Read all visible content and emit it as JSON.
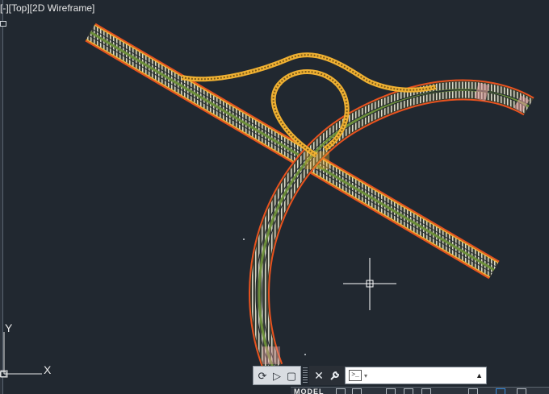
{
  "viewport": {
    "label": "[-][Top][2D Wireframe]",
    "background": "#212830",
    "ucs_y_label": "Y",
    "ucs_x_label": "X"
  },
  "colors": {
    "road_edge": "#e8521f",
    "road_shoulder": "#f0b132",
    "lane_marking": "#d9d9d9",
    "median": "#6b8e3a",
    "crosshair": "#ffffff"
  },
  "command_line": {
    "tools": [
      "customize-icon",
      "play-icon",
      "stop-icon"
    ],
    "close_label": "✕",
    "settings_label": "🔧",
    "prompt_icon": ">_",
    "placeholder": "",
    "history_arrow": "▲"
  },
  "status_bar": {
    "model_label": "MODEL"
  }
}
